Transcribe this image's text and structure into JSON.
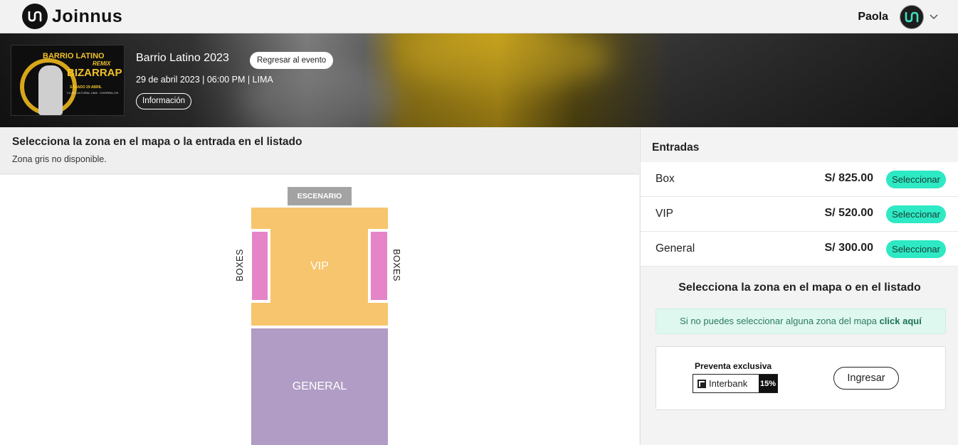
{
  "header": {
    "logo_text": "Joinnus",
    "user_name": "Paola"
  },
  "event": {
    "title": "Barrio Latino 2023",
    "back_button": "Regresar al evento",
    "date_line": "29 de abril 2023 | 06:00 PM | LIMA",
    "info_button": "Información",
    "poster": {
      "line1": "BARRIO LATINO",
      "line2": "REMIX",
      "line3": "BIZARRAP",
      "line4": "SÁBADO 29 ABRIL",
      "line5": "CLUB CULTURAL LIMA · CHORRILLOS"
    }
  },
  "map_panel": {
    "title": "Selecciona la zona en el mapa o la entrada en el listado",
    "subtitle": "Zona gris no disponible.",
    "zones": {
      "stage": "ESCENARIO",
      "vip": "VIP",
      "boxes_left": "BOXES",
      "boxes_right": "BOXES",
      "general": "GENERAL"
    }
  },
  "tickets_panel": {
    "title": "Entradas",
    "items": [
      {
        "name": "Box",
        "price": "S/ 825.00",
        "button": "Seleccionar"
      },
      {
        "name": "VIP",
        "price": "S/ 520.00",
        "button": "Seleccionar"
      },
      {
        "name": "General",
        "price": "S/ 300.00",
        "button": "Seleccionar"
      }
    ],
    "select_title": "Selecciona la zona en el mapa o en el listado",
    "hint_text": "Si no puedes seleccionar alguna zona del mapa ",
    "hint_link": "click aquí",
    "promo": {
      "label": "Preventa exclusiva",
      "bank": "Interbank",
      "discount": "15%",
      "button": "Ingresar"
    }
  },
  "colors": {
    "accent": "#2de9c4",
    "vip": "#f7c56d",
    "boxes": "#e585c7",
    "general": "#b09cc4",
    "stage": "#a3a3a3"
  }
}
